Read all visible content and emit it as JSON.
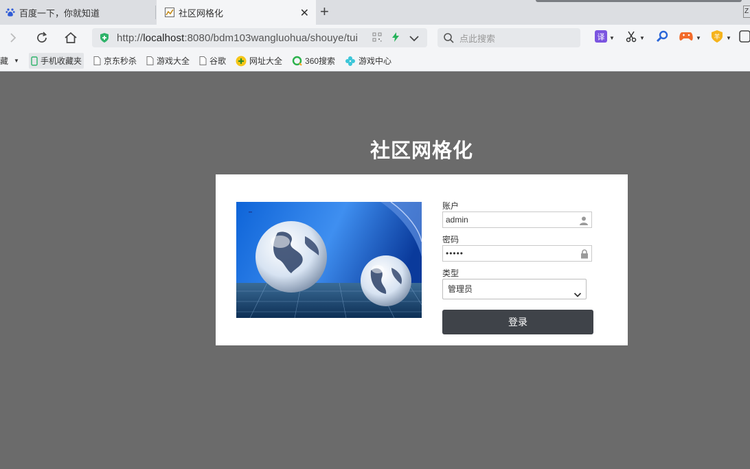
{
  "browser": {
    "tabs": [
      {
        "title": "百度一下，你就知道",
        "icon": "baidu-paw-icon"
      },
      {
        "title": "社区网格化",
        "icon": "page-favicon",
        "active": true
      }
    ],
    "address": {
      "prefix": "http://",
      "host": "localhost",
      "rest": ":8080/bdm103wangluohua/shouye/tui"
    },
    "search_placeholder": "点此搜索",
    "corner_text": "Z",
    "bookmarks": [
      {
        "label": "藏",
        "icon": "caret-down-icon"
      },
      {
        "label": "手机收藏夹",
        "icon": "phone-icon"
      },
      {
        "label": "京东秒杀",
        "icon": "page-icon"
      },
      {
        "label": "游戏大全",
        "icon": "page-icon"
      },
      {
        "label": "谷歌",
        "icon": "page-icon"
      },
      {
        "label": "网址大全",
        "icon": "site-nav-icon"
      },
      {
        "label": "360搜索",
        "icon": "search-360-icon"
      },
      {
        "label": "游戏中心",
        "icon": "clover-icon"
      }
    ],
    "accent": "#3cb371"
  },
  "page": {
    "title": "社区网格化",
    "background": "#6b6b6b",
    "form": {
      "account_label": "账户",
      "account_value": "admin",
      "password_label": "密码",
      "password_value": "•••••",
      "type_label": "类型",
      "type_value": "管理员",
      "submit_label": "登录"
    }
  }
}
